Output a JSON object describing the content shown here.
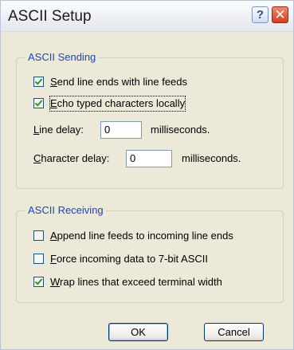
{
  "window": {
    "title": "ASCII Setup"
  },
  "titlebar_buttons": {
    "help": "?",
    "close": "✕"
  },
  "ascii_sending": {
    "legend": "ASCII Sending",
    "send_line_ends": {
      "label_first": "S",
      "label_rest": "end line ends with line feeds",
      "checked": true
    },
    "echo_typed": {
      "label_first": "E",
      "label_rest": "cho typed characters locally",
      "checked": true
    },
    "line_delay": {
      "label_first": "L",
      "label_rest": "ine delay:",
      "value": "0",
      "units": "milliseconds."
    },
    "character_delay": {
      "label_first": "C",
      "label_rest": "haracter delay:",
      "value": "0",
      "units": "milliseconds."
    }
  },
  "ascii_receiving": {
    "legend": "ASCII Receiving",
    "append_line_feeds": {
      "label_first": "A",
      "label_rest": "ppend line feeds to incoming line ends",
      "checked": false
    },
    "force_7bit": {
      "label_first": "F",
      "label_rest": "orce incoming data to 7-bit ASCII",
      "checked": false
    },
    "wrap_lines": {
      "label_first": "W",
      "label_rest": "rap lines that exceed terminal width",
      "checked": true
    }
  },
  "buttons": {
    "ok": "OK",
    "cancel": "Cancel"
  }
}
